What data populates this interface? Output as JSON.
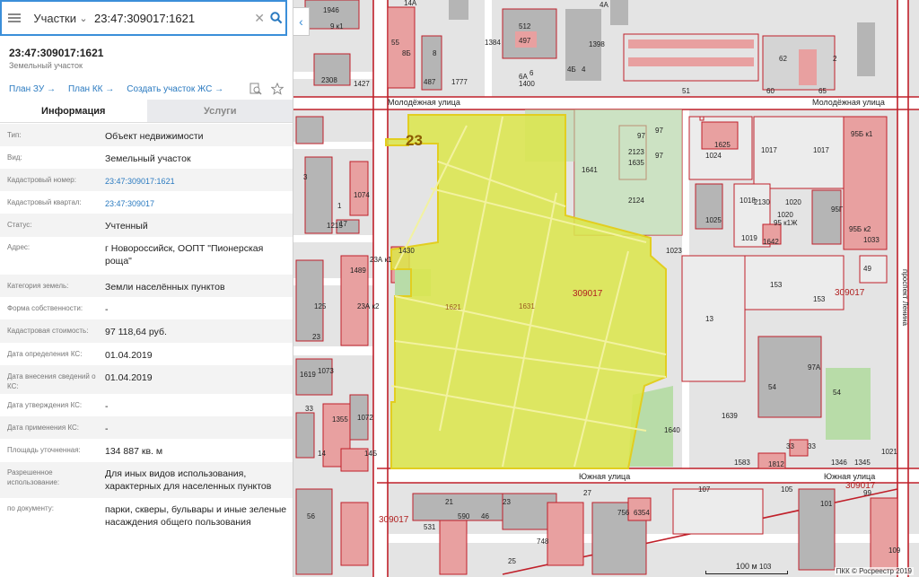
{
  "search": {
    "type_label": "Участки",
    "query": "23:47:309017:1621"
  },
  "object": {
    "title": "23:47:309017:1621",
    "subtitle": "Земельный участок"
  },
  "links": {
    "plan_zu": "План ЗУ →",
    "plan_kk": "План КК →",
    "create_zhs": "Создать участок ЖС →"
  },
  "tabs": {
    "info": "Информация",
    "services": "Услуги"
  },
  "properties": [
    {
      "label": "Тип:",
      "value": "Объект недвижимости"
    },
    {
      "label": "Вид:",
      "value": "Земельный участок"
    },
    {
      "label": "Кадастровый номер:",
      "value": "23:47:309017:1621",
      "link": true
    },
    {
      "label": "Кадастровый квартал:",
      "value": "23:47:309017",
      "link": true
    },
    {
      "label": "Статус:",
      "value": "Учтенный"
    },
    {
      "label": "Адрес:",
      "value": "г Новороссийск, ООПТ \"Пионерская роща\""
    },
    {
      "label": "Категория земель:",
      "value": "Земли населённых пунктов"
    },
    {
      "label": "Форма собственности:",
      "value": "-"
    },
    {
      "label": "Кадастровая стоимость:",
      "value": "97 118,64 руб."
    },
    {
      "label": "Дата определения КС:",
      "value": "01.04.2019"
    },
    {
      "label": "Дата внесения сведений о КС:",
      "value": "01.04.2019"
    },
    {
      "label": "Дата утверждения КС:",
      "value": "-"
    },
    {
      "label": "Дата применения КС:",
      "value": "-"
    },
    {
      "label": "Площадь уточненная:",
      "value": "134 887 кв. м"
    },
    {
      "label": "Разрешенное использование:",
      "value": "Для иных видов использования, характерных для населенных пунктов"
    },
    {
      "label": "по документу:",
      "value": "парки, скверы, бульвары и иные зеленые насаждения общего пользования"
    }
  ],
  "map": {
    "streets": {
      "molodezhnaya_left": "Молодёжная улица",
      "molodezhnaya_right": "Молодёжная улица",
      "yuzhnaya_mid": "Южная улица",
      "yuzhnaya_right": "Южная улица",
      "prospekt": "проспект Ленина"
    },
    "parcel_labels": {
      "main_quarter": "23",
      "p1621": "1621",
      "p1631": "1631",
      "q309017_center": "309017",
      "q309017_right": "309017",
      "q309017_bottom_right": "309017",
      "q309017_bottom_left": "309017"
    },
    "labels": [
      {
        "t": "1946",
        "k": "a1"
      },
      {
        "t": "9 к1",
        "k": "a2"
      },
      {
        "t": "14А",
        "k": "a3"
      },
      {
        "t": "4А",
        "k": "a4"
      },
      {
        "t": "55",
        "k": "a5"
      },
      {
        "t": "8Б",
        "k": "a6"
      },
      {
        "t": "8",
        "k": "a7"
      },
      {
        "t": "1384",
        "k": "a8"
      },
      {
        "t": "512",
        "k": "a9"
      },
      {
        "t": "497",
        "k": "a10"
      },
      {
        "t": "1398",
        "k": "a11"
      },
      {
        "t": "4Б",
        "k": "a12"
      },
      {
        "t": "4",
        "k": "a13"
      },
      {
        "t": "2308",
        "k": "a14"
      },
      {
        "t": "1427",
        "k": "a15"
      },
      {
        "t": "1777",
        "k": "a16"
      },
      {
        "t": "6А",
        "k": "a17"
      },
      {
        "t": "6",
        "k": "a18"
      },
      {
        "t": "1400",
        "k": "a19"
      },
      {
        "t": "487",
        "k": "a20"
      },
      {
        "t": "62",
        "k": "a21"
      },
      {
        "t": "2",
        "k": "a22"
      },
      {
        "t": "51",
        "k": "a23"
      },
      {
        "t": "60",
        "k": "a24"
      },
      {
        "t": "65",
        "k": "a25"
      },
      {
        "t": "97",
        "k": "b1"
      },
      {
        "t": "2123",
        "k": "b2"
      },
      {
        "t": "1635",
        "k": "b3"
      },
      {
        "t": "97",
        "k": "b4"
      },
      {
        "t": "97",
        "k": "b5"
      },
      {
        "t": "1641",
        "k": "b6"
      },
      {
        "t": "2124",
        "k": "b7"
      },
      {
        "t": "1625",
        "k": "b8"
      },
      {
        "t": "1024",
        "k": "b9"
      },
      {
        "t": "1017",
        "k": "b10"
      },
      {
        "t": "1017",
        "k": "b11"
      },
      {
        "t": "95Б к1",
        "k": "b12"
      },
      {
        "t": "1018",
        "k": "b13"
      },
      {
        "t": "2130",
        "k": "b14"
      },
      {
        "t": "1020",
        "k": "b15"
      },
      {
        "t": "1025",
        "k": "b16"
      },
      {
        "t": "95 к1Ж",
        "k": "b17"
      },
      {
        "t": "1020",
        "k": "b18"
      },
      {
        "t": "95Г",
        "k": "b19"
      },
      {
        "t": "1019",
        "k": "b20"
      },
      {
        "t": "1642",
        "k": "b21"
      },
      {
        "t": "1033",
        "k": "b22"
      },
      {
        "t": "95Б к2",
        "k": "b23"
      },
      {
        "t": "1023",
        "k": "b24"
      },
      {
        "t": "49",
        "k": "b25"
      },
      {
        "t": "153",
        "k": "b26"
      },
      {
        "t": "153",
        "k": "b27"
      },
      {
        "t": "13",
        "k": "b28"
      },
      {
        "t": "97А",
        "k": "b29"
      },
      {
        "t": "54",
        "k": "b30"
      },
      {
        "t": "54",
        "k": "b31"
      },
      {
        "t": "1639",
        "k": "b32"
      },
      {
        "t": "1640",
        "k": "b33"
      },
      {
        "t": "33",
        "k": "b34"
      },
      {
        "t": "33",
        "k": "b35"
      },
      {
        "t": "1346",
        "k": "b36"
      },
      {
        "t": "1345",
        "k": "b37"
      },
      {
        "t": "1021",
        "k": "b38"
      },
      {
        "t": "1583",
        "k": "b39"
      },
      {
        "t": "1812",
        "k": "b40"
      },
      {
        "t": "3",
        "k": "c1"
      },
      {
        "t": "1074",
        "k": "c2"
      },
      {
        "t": "1",
        "k": "c3"
      },
      {
        "t": "17",
        "k": "c4"
      },
      {
        "t": "1215",
        "k": "c5"
      },
      {
        "t": "1430",
        "k": "c6"
      },
      {
        "t": "1489",
        "k": "c7"
      },
      {
        "t": "125",
        "k": "c8"
      },
      {
        "t": "23А к2",
        "k": "c9"
      },
      {
        "t": "23А к1",
        "k": "c10"
      },
      {
        "t": "23",
        "k": "c11"
      },
      {
        "t": "1073",
        "k": "c12"
      },
      {
        "t": "1619",
        "k": "c13"
      },
      {
        "t": "33",
        "k": "c14"
      },
      {
        "t": "1355",
        "k": "c15"
      },
      {
        "t": "1072",
        "k": "c16"
      },
      {
        "t": "14",
        "k": "c17"
      },
      {
        "t": "14Б",
        "k": "c18"
      },
      {
        "t": "107",
        "k": "d1"
      },
      {
        "t": "105",
        "k": "d2"
      },
      {
        "t": "99",
        "k": "d3"
      },
      {
        "t": "101",
        "k": "d4"
      },
      {
        "t": "27",
        "k": "d5"
      },
      {
        "t": "21",
        "k": "d6"
      },
      {
        "t": "23",
        "k": "d7"
      },
      {
        "t": "56",
        "k": "d8"
      },
      {
        "t": "46",
        "k": "d9"
      },
      {
        "t": "25",
        "k": "d10"
      },
      {
        "t": "748",
        "k": "d11"
      },
      {
        "t": "756",
        "k": "d12"
      },
      {
        "t": "6354",
        "k": "d13"
      },
      {
        "t": "103",
        "k": "d14"
      },
      {
        "t": "109",
        "k": "d15"
      },
      {
        "t": "531",
        "k": "d16"
      },
      {
        "t": "590",
        "k": "d17"
      }
    ]
  },
  "scale_label": "100 м",
  "attribution": "ПКК © Росреестр 2019"
}
